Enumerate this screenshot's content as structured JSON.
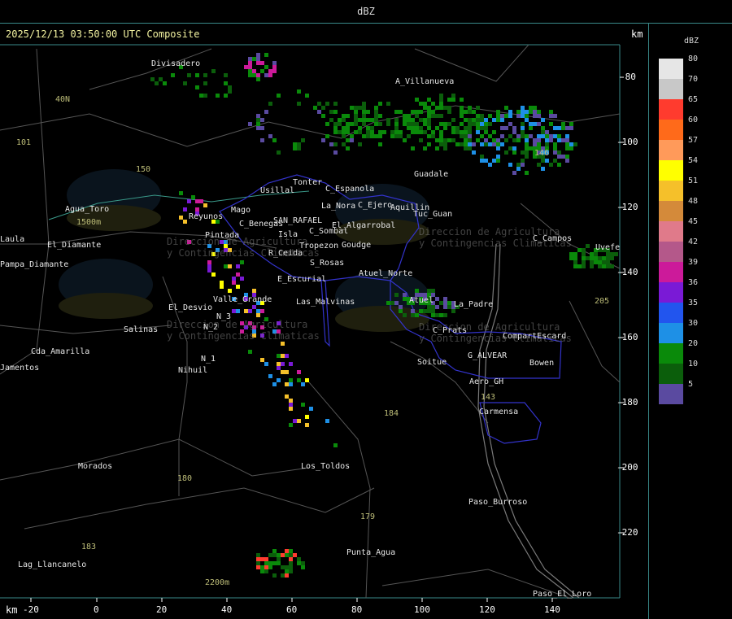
{
  "header": {
    "unit_title": "dBZ",
    "timestamp": "2025/12/13 03:50:00 UTC Composite",
    "km_label_top": "km",
    "km_label_bottom": "km"
  },
  "axes": {
    "x_ticks": [
      "-20",
      "0",
      "20",
      "40",
      "60",
      "80",
      "100",
      "120",
      "140"
    ],
    "y_ticks": [
      "-80",
      "-100",
      "-120",
      "-140",
      "-160",
      "-180",
      "-200",
      "-220"
    ]
  },
  "legend": {
    "title": "dBZ",
    "levels": [
      {
        "label": "80",
        "color": "#e6e6e6"
      },
      {
        "label": "70",
        "color": "#c8c8c8"
      },
      {
        "label": "65",
        "color": "#ff3b2e"
      },
      {
        "label": "60",
        "color": "#ff6a1a"
      },
      {
        "label": "57",
        "color": "#ff9a5a"
      },
      {
        "label": "54",
        "color": "#ffff00"
      },
      {
        "label": "51",
        "color": "#f5c02a"
      },
      {
        "label": "48",
        "color": "#d48a3a"
      },
      {
        "label": "45",
        "color": "#e07a8a"
      },
      {
        "label": "42",
        "color": "#b4588a"
      },
      {
        "label": "39",
        "color": "#cc1a9a"
      },
      {
        "label": "36",
        "color": "#7a1ad6"
      },
      {
        "label": "35",
        "color": "#2255ee"
      },
      {
        "label": "30",
        "color": "#1e90e6"
      },
      {
        "label": "20",
        "color": "#0a8a0a"
      },
      {
        "label": "10",
        "color": "#0b5e0b"
      },
      {
        "label": "5",
        "color": "#5a4aa0"
      }
    ]
  },
  "places": [
    "Divisadero",
    "A_Villanueva",
    "40N",
    "101",
    "Guadale",
    "Tonter",
    "Usillal",
    "C_Espanola",
    "C_Ejero",
    "Aquillin",
    "La_Nora",
    "Tuc_Guan",
    "Reyunos",
    "Mago",
    "C_Benegas",
    "SAN_RAFAEL",
    "El_Algarrobal",
    "C_Sombal",
    "Isla",
    "Tropezon",
    "Goudge",
    "Pintada",
    "R_Ceida",
    "S_Rosas",
    "Atuel_Norte",
    "C_Campos",
    "Uvefe",
    "Agua_Toro",
    "1500m",
    "Laula",
    "Pampa_Diamante",
    "El_Diamante",
    "E_Escurial",
    "Valle_Grande",
    "Las_Malvinas",
    "Atuel",
    "La_Padre",
    "El_Desvio",
    "Salinas",
    "N_2",
    "N_3",
    "N_1",
    "Nihuil",
    "Cda_Amarilla",
    "Jamentos",
    "C_Prats",
    "CompartEscard",
    "G_ALVEAR",
    "Soitue",
    "Bowen",
    "Aero_GH",
    "Carmensa",
    "Los_Toldos",
    "Morados",
    "Paso_Burroso",
    "Punta_Agua",
    "Lag_Llancanelo",
    "Paso_El_Loro",
    "2200m",
    "205",
    "143",
    "146",
    "179",
    "184",
    "180",
    "183",
    "150"
  ],
  "watermark": {
    "brand": "DACC",
    "line1": "Direccion de Agricultura",
    "line2": "y Contingencias Climaticas"
  }
}
